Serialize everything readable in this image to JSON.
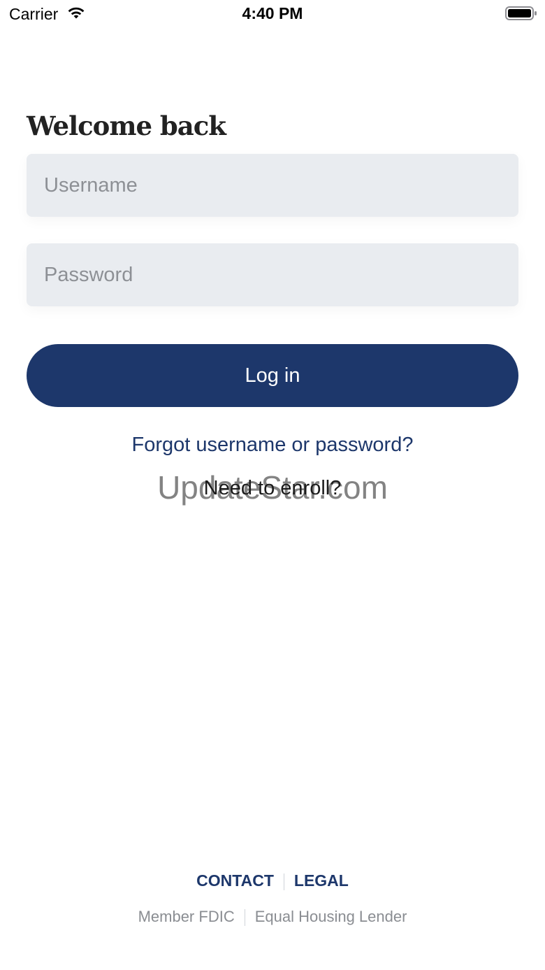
{
  "status_bar": {
    "carrier": "Carrier",
    "time": "4:40 PM",
    "wifi_icon": "wifi-icon",
    "battery_icon": "battery-icon"
  },
  "login": {
    "title": "Welcome back",
    "username_placeholder": "Username",
    "username_value": "",
    "password_placeholder": "Password",
    "password_value": "",
    "login_button": "Log in",
    "forgot_link": "Forgot username or password?",
    "enroll_link": "Need to enroll?"
  },
  "watermark": "UpdateStar.com",
  "footer": {
    "contact": "CONTACT",
    "legal": "LEGAL",
    "member_fdic": "Member FDIC",
    "equal_housing": "Equal Housing Lender"
  },
  "colors": {
    "brand_navy": "#1d376b",
    "input_background": "#e9ecf0",
    "footer_gray": "#8a8d92"
  }
}
